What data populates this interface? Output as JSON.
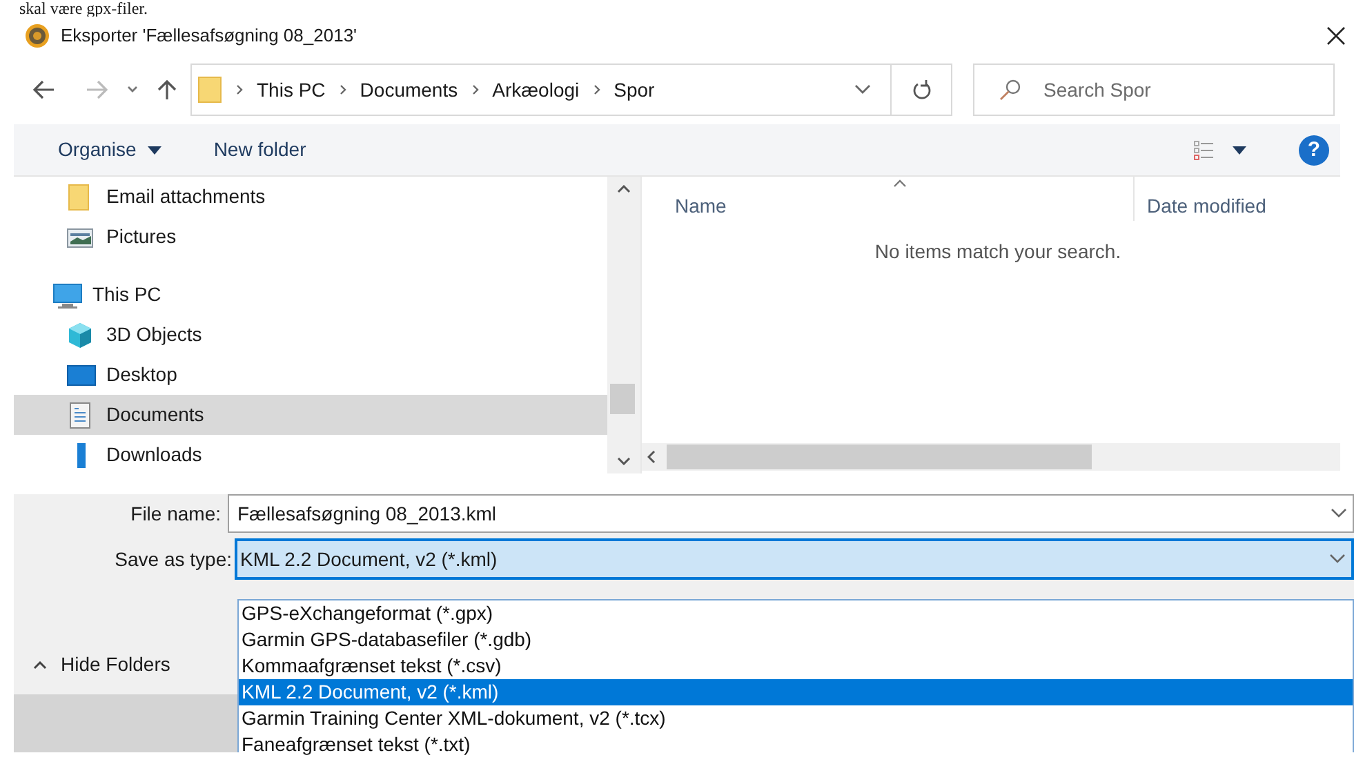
{
  "caption": "skal være gpx-filer.",
  "window": {
    "title": "Eksporter 'Fællesafsøgning 08_2013'"
  },
  "address_bar": {
    "breadcrumbs": [
      "This PC",
      "Documents",
      "Arkæologi",
      "Spor"
    ]
  },
  "search": {
    "placeholder": "Search Spor"
  },
  "toolbar": {
    "organise": "Organise",
    "new_folder": "New folder"
  },
  "nav": [
    {
      "label": "Email attachments",
      "kind": "folder",
      "selected": false
    },
    {
      "label": "Pictures",
      "kind": "pictures",
      "selected": false
    },
    {
      "label": "This PC",
      "kind": "pc",
      "selected": false
    },
    {
      "label": "3D Objects",
      "kind": "cube",
      "selected": false
    },
    {
      "label": "Desktop",
      "kind": "desktop",
      "selected": false
    },
    {
      "label": "Documents",
      "kind": "documents",
      "selected": true
    },
    {
      "label": "Downloads",
      "kind": "downloads",
      "selected": false
    }
  ],
  "file_list": {
    "columns": [
      "Name",
      "Date modified"
    ],
    "empty_message": "No items match your search."
  },
  "file_name": {
    "label": "File name:",
    "value": "Fællesafsøgning 08_2013.kml"
  },
  "save_as_type": {
    "label": "Save as type:",
    "value": "KML 2.2 Document, v2 (*.kml)",
    "options": [
      {
        "label": "GPS-eXchangeformat (*.gpx)",
        "selected": false
      },
      {
        "label": "Garmin GPS-databasefiler (*.gdb)",
        "selected": false
      },
      {
        "label": "Kommaafgrænset tekst (*.csv)",
        "selected": false
      },
      {
        "label": "KML 2.2 Document, v2 (*.kml)",
        "selected": true
      },
      {
        "label": "Garmin Training Center XML-dokument, v2 (*.tcx)",
        "selected": false
      },
      {
        "label": "Faneafgrænset tekst (*.txt)",
        "selected": false
      }
    ]
  },
  "hide_folders": "Hide Folders",
  "help": "?"
}
